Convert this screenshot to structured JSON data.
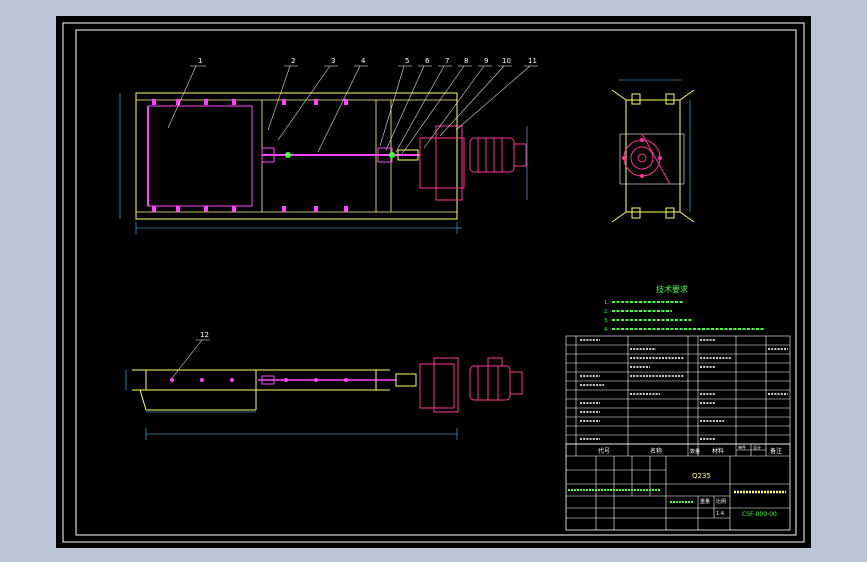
{
  "colors": {
    "background": "#bcc5d6",
    "sheet": "#000000",
    "frame": "#ffffff",
    "outline": "#ffff66",
    "part": "#ff44ff",
    "motor": "#ff3399",
    "note_green": "#44ff44",
    "leader": "#dddddd"
  },
  "balloons": [
    "1",
    "2",
    "3",
    "4",
    "5",
    "6",
    "7",
    "8",
    "9",
    "10",
    "11",
    "12"
  ],
  "notes": {
    "heading": "技术要求",
    "items": [
      "1.",
      "2.",
      "3.",
      "4."
    ]
  },
  "title_block": {
    "header": {
      "code": "代号",
      "name": "名称",
      "qty": "数量",
      "material": "材料",
      "remark": "备注",
      "unit": "单件",
      "total": "总计"
    },
    "material_cell": "Q235",
    "drawing_no": "CSF-000-00",
    "scale_label": "比例",
    "weight_label": "重量",
    "scale_value": "1:4"
  }
}
